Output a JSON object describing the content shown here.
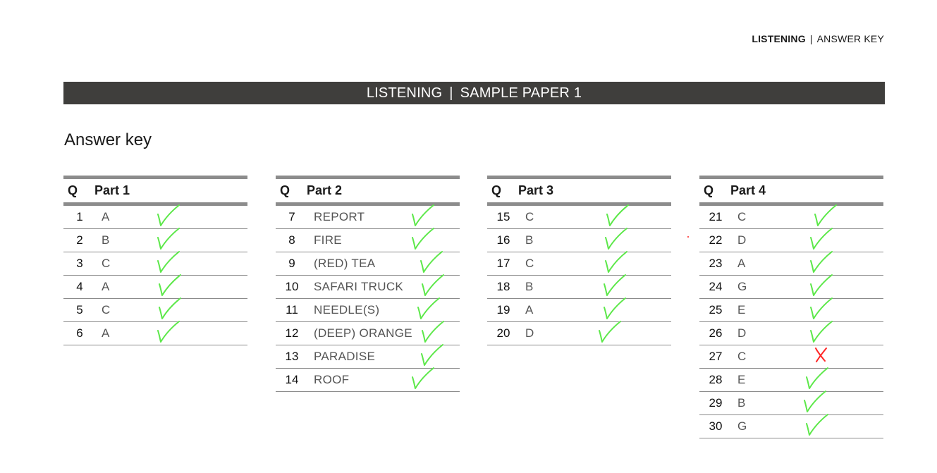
{
  "running_head": {
    "bold": "LISTENING",
    "separator": "|",
    "rest": "ANSWER KEY"
  },
  "title_bar": {
    "left": "LISTENING",
    "separator": "|",
    "right": "SAMPLE PAPER 1"
  },
  "heading": "Answer key",
  "colors": {
    "tick": "#5de84a",
    "cross": "#ff2626",
    "bar": "#3f3e3c",
    "rule": "#8c8c8c"
  },
  "tables": [
    {
      "q_label": "Q",
      "part_label": "Part 1",
      "rows": [
        {
          "num": "1",
          "answer": "A",
          "mark": "tick-icon"
        },
        {
          "num": "2",
          "answer": "B",
          "mark": "tick-icon"
        },
        {
          "num": "3",
          "answer": "C",
          "mark": "tick-icon"
        },
        {
          "num": "4",
          "answer": "A",
          "mark": "tick-icon"
        },
        {
          "num": "5",
          "answer": "C",
          "mark": "tick-icon"
        },
        {
          "num": "6",
          "answer": "A",
          "mark": "tick-icon"
        }
      ]
    },
    {
      "q_label": "Q",
      "part_label": "Part 2",
      "rows": [
        {
          "num": "7",
          "answer": "REPORT",
          "mark": "tick-icon"
        },
        {
          "num": "8",
          "answer": "FIRE",
          "mark": "tick-icon"
        },
        {
          "num": "9",
          "answer": "(RED) TEA",
          "mark": "tick-icon"
        },
        {
          "num": "10",
          "answer": "SAFARI TRUCK",
          "mark": "tick-icon"
        },
        {
          "num": "11",
          "answer": "NEEDLE(S)",
          "mark": "tick-icon"
        },
        {
          "num": "12",
          "answer": "(DEEP) ORANGE",
          "mark": "tick-icon"
        },
        {
          "num": "13",
          "answer": "PARADISE",
          "mark": "tick-icon"
        },
        {
          "num": "14",
          "answer": "ROOF",
          "mark": "tick-icon"
        }
      ]
    },
    {
      "q_label": "Q",
      "part_label": "Part 3",
      "rows": [
        {
          "num": "15",
          "answer": "C",
          "mark": "tick-icon"
        },
        {
          "num": "16",
          "answer": "B",
          "mark": "tick-icon"
        },
        {
          "num": "17",
          "answer": "C",
          "mark": "tick-icon"
        },
        {
          "num": "18",
          "answer": "B",
          "mark": "tick-icon"
        },
        {
          "num": "19",
          "answer": "A",
          "mark": "tick-icon"
        },
        {
          "num": "20",
          "answer": "D",
          "mark": "tick-icon"
        }
      ]
    },
    {
      "q_label": "Q",
      "part_label": "Part 4",
      "rows": [
        {
          "num": "21",
          "answer": "C",
          "mark": "tick-icon"
        },
        {
          "num": "22",
          "answer": "D",
          "mark": "tick-icon"
        },
        {
          "num": "23",
          "answer": "A",
          "mark": "tick-icon"
        },
        {
          "num": "24",
          "answer": "G",
          "mark": "tick-icon"
        },
        {
          "num": "25",
          "answer": "E",
          "mark": "tick-icon"
        },
        {
          "num": "26",
          "answer": "D",
          "mark": "tick-icon"
        },
        {
          "num": "27",
          "answer": "C",
          "mark": "cross-icon"
        },
        {
          "num": "28",
          "answer": "E",
          "mark": "tick-icon"
        },
        {
          "num": "29",
          "answer": "B",
          "mark": "tick-icon"
        },
        {
          "num": "30",
          "answer": "G",
          "mark": "tick-icon"
        }
      ]
    }
  ]
}
